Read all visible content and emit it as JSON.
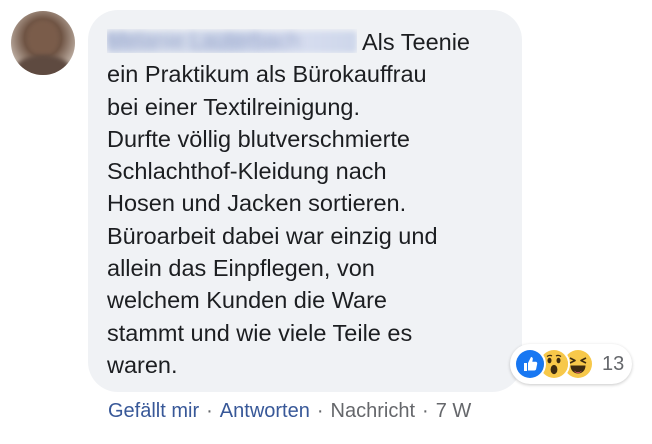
{
  "comment": {
    "author_name": "Melanie Lauterbach",
    "text": "Als Teenie\nein Praktikum als Bürokauffrau\nbei einer Textilreinigung.\nDurfte völlig blutverschmierte\nSchlachthof-Kleidung nach\nHosen und Jacken sortieren.\nBüroarbeit dabei war einzig und\nallein das Einpflegen, von\nwelchem Kunden die Ware\nstammt und wie viele Teile es\nwaren."
  },
  "reactions": {
    "icons": [
      "like-icon",
      "wow-icon",
      "haha-icon"
    ],
    "count": "13"
  },
  "actions": {
    "like": "Gefällt mir",
    "reply": "Antworten",
    "message": "Nachricht",
    "separator": "·",
    "timestamp": "7 W"
  },
  "colors": {
    "bubble": "#f0f2f5",
    "link": "#385898",
    "muted": "#65676b",
    "text": "#1c1e21",
    "like_blue": "#1877f2",
    "emoji_yellow": "#f7c84a"
  }
}
